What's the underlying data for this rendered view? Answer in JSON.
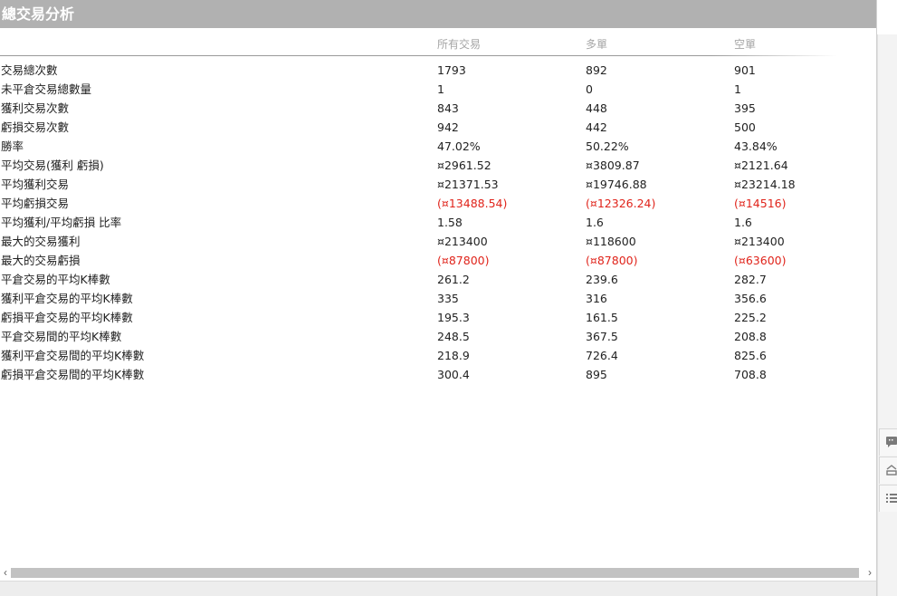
{
  "title": "總交易分析",
  "columns": [
    "",
    "所有交易",
    "多單",
    "空單"
  ],
  "rows": [
    {
      "label": "交易總次數",
      "all": "1793",
      "long": "892",
      "short": "901",
      "negative": false
    },
    {
      "label": "未平倉交易總數量",
      "all": "1",
      "long": "0",
      "short": "1",
      "negative": false
    },
    {
      "label": "獲利交易次數",
      "all": "843",
      "long": "448",
      "short": "395",
      "negative": false
    },
    {
      "label": "虧損交易次數",
      "all": "942",
      "long": "442",
      "short": "500",
      "negative": false
    },
    {
      "label": "勝率",
      "all": "47.02%",
      "long": "50.22%",
      "short": "43.84%",
      "negative": false
    },
    {
      "label": "平均交易(獲利 虧損)",
      "all": "¤2961.52",
      "long": "¤3809.87",
      "short": "¤2121.64",
      "negative": false
    },
    {
      "label": "平均獲利交易",
      "all": "¤21371.53",
      "long": "¤19746.88",
      "short": "¤23214.18",
      "negative": false
    },
    {
      "label": "平均虧損交易",
      "all": "(¤13488.54)",
      "long": "(¤12326.24)",
      "short": "(¤14516)",
      "negative": true
    },
    {
      "label": "平均獲利/平均虧損 比率",
      "all": "1.58",
      "long": "1.6",
      "short": "1.6",
      "negative": false
    },
    {
      "label": "最大的交易獲利",
      "all": "¤213400",
      "long": "¤118600",
      "short": "¤213400",
      "negative": false
    },
    {
      "label": "最大的交易虧損",
      "all": "(¤87800)",
      "long": "(¤87800)",
      "short": "(¤63600)",
      "negative": true
    },
    {
      "label": "平倉交易的平均K棒數",
      "all": "261.2",
      "long": "239.6",
      "short": "282.7",
      "negative": false
    },
    {
      "label": "獲利平倉交易的平均K棒數",
      "all": "335",
      "long": "316",
      "short": "356.6",
      "negative": false
    },
    {
      "label": "虧損平倉交易的平均K棒數",
      "all": "195.3",
      "long": "161.5",
      "short": "225.2",
      "negative": false
    },
    {
      "label": "平倉交易間的平均K棒數",
      "all": "248.5",
      "long": "367.5",
      "short": "208.8",
      "negative": false
    },
    {
      "label": "獲利平倉交易間的平均K棒數",
      "all": "218.9",
      "long": "726.4",
      "short": "825.6",
      "negative": false
    },
    {
      "label": "虧損平倉交易間的平均K棒數",
      "all": "300.4",
      "long": "895",
      "short": "708.8",
      "negative": false
    }
  ],
  "colors": {
    "title_bar": "#b1b1b1",
    "negative": "#e0241b",
    "header_text": "#a6a6a6"
  },
  "icons": {
    "scroll_left": "chevron-left-icon",
    "scroll_right": "chevron-right-icon",
    "side_1": "comment-icon",
    "side_2": "layers-icon",
    "side_3": "list-icon"
  },
  "scroll": {
    "left_glyph": "‹",
    "right_glyph": "›"
  }
}
